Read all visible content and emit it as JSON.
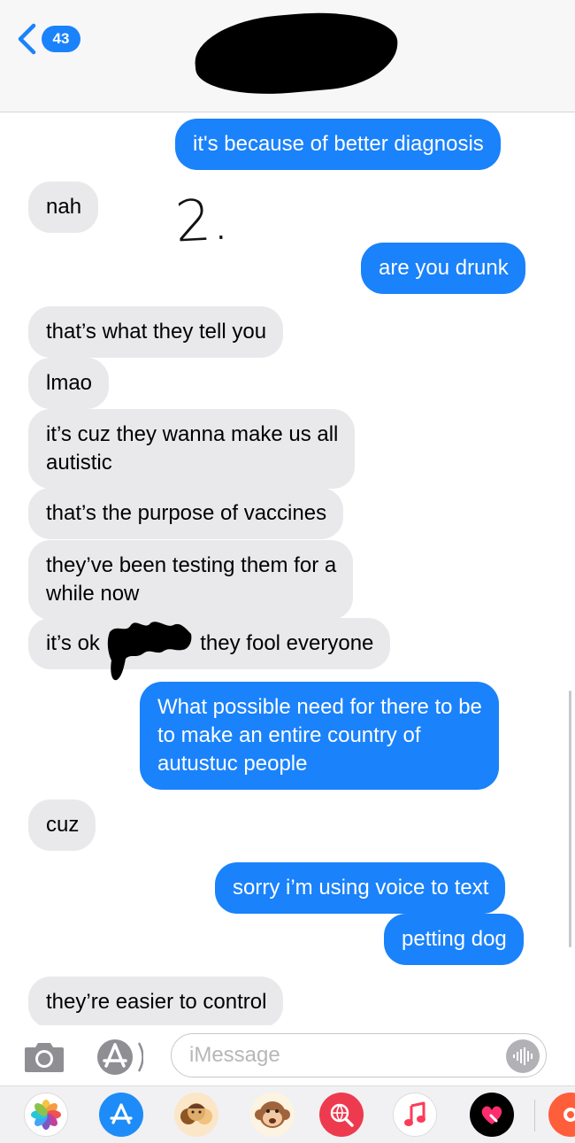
{
  "header": {
    "back_count": "43"
  },
  "annotation": "2.",
  "messages": [
    {
      "side": "out",
      "text": "it's because of better diagnosis"
    },
    {
      "side": "in",
      "text": "nah"
    },
    {
      "side": "out",
      "text": "are you drunk"
    },
    {
      "side": "in",
      "text": "that’s what they tell you"
    },
    {
      "side": "in",
      "text": "lmao"
    },
    {
      "side": "in",
      "lines": [
        "it’s cuz they wanna make us all",
        "autistic"
      ]
    },
    {
      "side": "in",
      "text": "that’s the purpose of vaccines"
    },
    {
      "side": "in",
      "lines": [
        "they’ve been testing them for a",
        "while now"
      ]
    },
    {
      "side": "in",
      "before_redaction": "it’s ok",
      "after_redaction": "they fool everyone"
    },
    {
      "side": "out",
      "lines": [
        "What possible need for there to be",
        "to make an entire country of",
        "autustuc people"
      ]
    },
    {
      "side": "in",
      "text": "cuz"
    },
    {
      "side": "out",
      "text": "sorry i’m using voice to text"
    },
    {
      "side": "out",
      "text": "petting dog"
    },
    {
      "side": "in",
      "text": "they’re easier to control"
    }
  ],
  "input": {
    "placeholder": "iMessage"
  },
  "app_drawer": [
    "photos-icon",
    "app-store-icon",
    "memoji-icon",
    "animoji-monkey-icon",
    "web-search-icon",
    "music-icon",
    "digital-touch-icon",
    "more-app-icon"
  ],
  "colors": {
    "outgoing_bubble": "#1a82fb",
    "incoming_bubble": "#e9e9eb",
    "header_bg": "#f7f7f8"
  }
}
